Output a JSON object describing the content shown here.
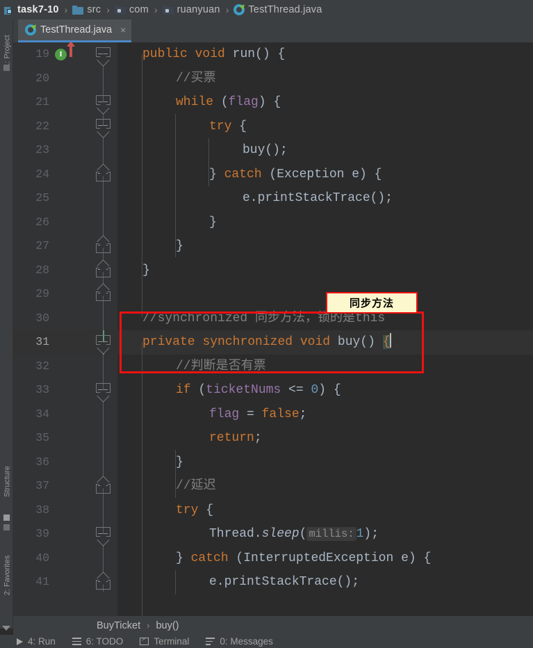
{
  "breadcrumb": {
    "items": [
      {
        "label": "task7-10",
        "icon": "module-icon"
      },
      {
        "label": "src",
        "icon": "source-folder-icon"
      },
      {
        "label": "com",
        "icon": "package-folder-icon"
      },
      {
        "label": "ruanyuan",
        "icon": "package-folder-icon"
      },
      {
        "label": "TestThread.java",
        "icon": "java-class-icon"
      }
    ],
    "separator": "›"
  },
  "tool_stripe": {
    "project_label": "1: Project",
    "structure_label": "Structure",
    "favorites_label": "2: Favorites"
  },
  "editor_tab": {
    "label": "TestThread.java",
    "close": "×",
    "icon": "java-class-icon"
  },
  "editor": {
    "lines": [
      {
        "num": "19"
      },
      {
        "num": "20"
      },
      {
        "num": "21"
      },
      {
        "num": "22"
      },
      {
        "num": "23"
      },
      {
        "num": "24"
      },
      {
        "num": "25"
      },
      {
        "num": "26"
      },
      {
        "num": "27"
      },
      {
        "num": "28"
      },
      {
        "num": "29"
      },
      {
        "num": "30"
      },
      {
        "num": "31"
      },
      {
        "num": "32"
      },
      {
        "num": "33"
      },
      {
        "num": "34"
      },
      {
        "num": "35"
      },
      {
        "num": "36"
      },
      {
        "num": "37"
      },
      {
        "num": "38"
      },
      {
        "num": "39"
      },
      {
        "num": "40"
      },
      {
        "num": "41"
      }
    ],
    "code": {
      "l19_kw1": "public",
      "l19_kw2": "void",
      "l19_name": " run() {",
      "l20_comment": "//买票",
      "l21_kw": "while",
      "l21_a": " (",
      "l21_var": "flag",
      "l21_b": ") {",
      "l22_kw": "try",
      "l22_a": " {",
      "l23_text": "buy();",
      "l24_a": "} ",
      "l24_kw": "catch",
      "l24_b": " (Exception e) {",
      "l25_text": "e.printStackTrace();",
      "l26_text": "}",
      "l27_text": "}",
      "l28_text": "}",
      "l30_comment": "//synchronized 同步方法，锁的是this",
      "l31_kw1": "private",
      "l31_kw2": "synchronized",
      "l31_kw3": "void",
      "l31_name": " buy() ",
      "l31_brace": "{",
      "l32_comment": "//判断是否有票",
      "l33_kw": "if",
      "l33_a": " (",
      "l33_var": "ticketNums",
      "l33_b": " <= ",
      "l33_num": "0",
      "l33_c": ") {",
      "l34_var": "flag",
      "l34_a": " = ",
      "l34_kw": "false",
      "l34_b": ";",
      "l35_kw": "return",
      "l35_a": ";",
      "l36_text": "}",
      "l37_comment": "//延迟",
      "l38_kw": "try",
      "l38_a": " {",
      "l39_a": "Thread.",
      "l39_m": "sleep",
      "l39_b": "(",
      "l39_hint": "millis:",
      "l39_num": "1",
      "l39_c": ");",
      "l40_a": "} ",
      "l40_kw": "catch",
      "l40_b": " (InterruptedException e) {",
      "l41_text": "e.printStackTrace();"
    },
    "gutter_glyphs": {
      "implements_marker": "I"
    }
  },
  "annotation": {
    "note_text": "同步方法",
    "note_border_color": "#ee1111",
    "note_background_color": "#fdf7cd",
    "highlight_border_color": "#ee1111"
  },
  "bottom_breadcrumb": {
    "class": "BuyTicket",
    "separator": "›",
    "method": "buy()"
  },
  "tool_window_bar": {
    "items": [
      {
        "label": "4: Run",
        "icon": "run-icon"
      },
      {
        "label": "6: TODO",
        "icon": "todo-icon"
      },
      {
        "label": "Terminal",
        "icon": "terminal-icon"
      },
      {
        "label": "0: Messages",
        "icon": "messages-icon"
      }
    ]
  }
}
